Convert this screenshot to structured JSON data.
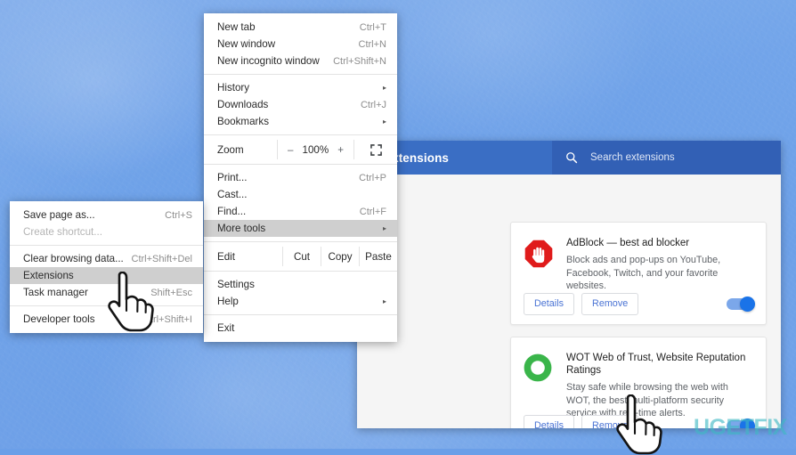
{
  "desktop": {
    "wallpaper_color": "#6b9fe8"
  },
  "extensions_window": {
    "title": "Extensions",
    "header_color": "#3a6ec4",
    "search": {
      "placeholder": "Search extensions",
      "icon": "search-icon",
      "value": ""
    },
    "cards": [
      {
        "icon": "adblock-stop-hand-icon",
        "icon_color": "#e01b1b",
        "name": "AdBlock — best ad blocker",
        "description": "Block ads and pop-ups on YouTube, Facebook, Twitch, and your favorite websites.",
        "details_label": "Details",
        "remove_label": "Remove",
        "enabled": true,
        "toggle_color": "#1a73e8"
      },
      {
        "icon": "wot-ring-icon",
        "icon_color": "#3ab54a",
        "name": "WOT Web of Trust, Website Reputation Ratings",
        "description": "Stay safe while browsing the web with WOT, the best multi-platform security service with real-time alerts.",
        "details_label": "Details",
        "remove_label": "Remove",
        "enabled": true,
        "toggle_color": "#1a73e8"
      }
    ]
  },
  "chrome_menu": {
    "items": [
      {
        "label": "New tab",
        "accel": "Ctrl+T"
      },
      {
        "label": "New window",
        "accel": "Ctrl+N"
      },
      {
        "label": "New incognito window",
        "accel": "Ctrl+Shift+N"
      },
      {
        "label": "History",
        "accel": "",
        "submenu": true
      },
      {
        "label": "Downloads",
        "accel": "Ctrl+J"
      },
      {
        "label": "Bookmarks",
        "accel": "",
        "submenu": true
      },
      {
        "label": "Print...",
        "accel": "Ctrl+P"
      },
      {
        "label": "Cast...",
        "accel": ""
      },
      {
        "label": "Find...",
        "accel": "Ctrl+F"
      },
      {
        "label": "More tools",
        "accel": "",
        "submenu": true,
        "highlighted": true
      },
      {
        "label": "Settings",
        "accel": ""
      },
      {
        "label": "Help",
        "accel": "",
        "submenu": true
      },
      {
        "label": "Exit",
        "accel": ""
      }
    ],
    "zoom_row": {
      "label": "Zoom",
      "minus": "–",
      "value": "100%",
      "plus": "+",
      "fullscreen_icon": "fullscreen-icon"
    },
    "edit_row": {
      "label": "Edit",
      "cut": "Cut",
      "copy": "Copy",
      "paste": "Paste"
    },
    "arrow_glyph": "▸"
  },
  "more_tools_menu": {
    "items": [
      {
        "label": "Save page as...",
        "accel": "Ctrl+S",
        "disabled": false
      },
      {
        "label": "Create shortcut...",
        "accel": "",
        "disabled": true
      },
      {
        "label": "Clear browsing data...",
        "accel": "Ctrl+Shift+Del",
        "disabled": false
      },
      {
        "label": "Extensions",
        "accel": "",
        "disabled": false,
        "highlighted": true
      },
      {
        "label": "Task manager",
        "accel": "Shift+Esc",
        "disabled": false
      },
      {
        "label": "Developer tools",
        "accel": "Ctrl+Shift+I",
        "disabled": false
      }
    ]
  },
  "cursors": [
    {
      "name": "hand-cursor-over-extensions"
    },
    {
      "name": "hand-cursor-over-remove"
    }
  ],
  "watermark": {
    "text": "UGETFIX",
    "color": "#3fb9c4"
  }
}
